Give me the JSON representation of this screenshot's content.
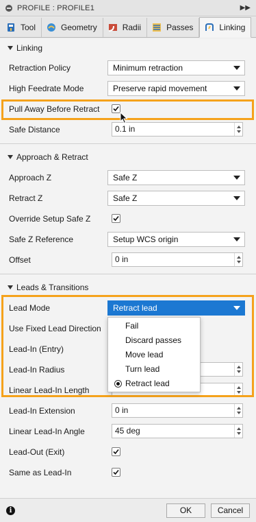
{
  "window": {
    "title": "PROFILE : PROFILE1",
    "expand_icon": "double-chevron-right-icon"
  },
  "tabs": [
    {
      "label": "Tool",
      "icon": "tool-icon"
    },
    {
      "label": "Geometry",
      "icon": "geometry-icon"
    },
    {
      "label": "Radii",
      "icon": "radii-icon"
    },
    {
      "label": "Passes",
      "icon": "passes-icon"
    },
    {
      "label": "Linking",
      "icon": "linking-icon",
      "active": true
    }
  ],
  "sections": {
    "linking": {
      "title": "Linking",
      "retraction_policy": {
        "label": "Retraction Policy",
        "value": "Minimum retraction"
      },
      "high_feedrate_mode": {
        "label": "High Feedrate Mode",
        "value": "Preserve rapid movement"
      },
      "pull_away": {
        "label": "Pull Away Before Retract",
        "checked": true
      },
      "safe_distance": {
        "label": "Safe Distance",
        "value": "0.1 in"
      }
    },
    "approach": {
      "title": "Approach & Retract",
      "approach_z": {
        "label": "Approach Z",
        "value": "Safe Z"
      },
      "retract_z": {
        "label": "Retract Z",
        "value": "Safe Z"
      },
      "override_safe_z": {
        "label": "Override Setup Safe Z",
        "checked": true
      },
      "safe_z_reference": {
        "label": "Safe Z Reference",
        "value": "Setup WCS origin"
      },
      "offset": {
        "label": "Offset",
        "value": "0 in"
      }
    },
    "leads": {
      "title": "Leads & Transitions",
      "lead_mode": {
        "label": "Lead Mode",
        "value": "Retract lead"
      },
      "fixed_lead_direction": {
        "label": "Use Fixed Lead Direction"
      },
      "lead_in_entry": {
        "label": "Lead-In (Entry)"
      },
      "lead_in_radius": {
        "label": "Lead-In Radius"
      },
      "linear_lead_in_length": {
        "label": "Linear Lead-In Length"
      },
      "lead_in_extension": {
        "label": "Lead-In Extension",
        "value": "0 in"
      },
      "linear_lead_in_angle": {
        "label": "Linear Lead-In Angle",
        "value": "45 deg"
      },
      "lead_out_exit": {
        "label": "Lead-Out (Exit)",
        "checked": true
      },
      "same_as_lead_in": {
        "label": "Same as Lead-In",
        "checked": true
      }
    }
  },
  "lead_mode_options": [
    "Fail",
    "Discard passes",
    "Move lead",
    "Turn lead",
    "Retract lead"
  ],
  "lead_mode_selected": "Retract lead",
  "footer": {
    "ok_label": "OK",
    "cancel_label": "Cancel",
    "info_icon": "info-icon"
  },
  "colors": {
    "highlight": "#f5a21b",
    "accent": "#1c78d2"
  }
}
